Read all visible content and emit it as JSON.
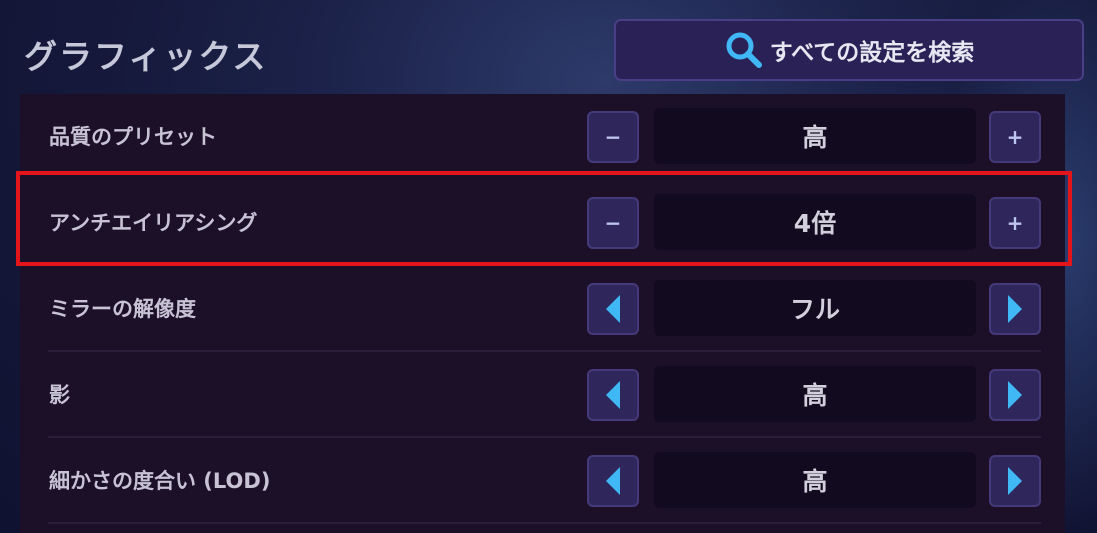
{
  "header": {
    "title": "グラフィックス",
    "search_label": "すべての設定を検索"
  },
  "settings": [
    {
      "label": "品質のプリセット",
      "value": "高",
      "control": "stepper",
      "decrement": "−",
      "increment": "+"
    },
    {
      "label": "アンチエイリアシング",
      "value": "4倍",
      "control": "stepper",
      "decrement": "−",
      "increment": "+",
      "highlighted": true
    },
    {
      "label": "ミラーの解像度",
      "value": "フル",
      "control": "arrows"
    },
    {
      "label": "影",
      "value": "高",
      "control": "arrows"
    },
    {
      "label": "細かさの度合い (LOD)",
      "value": "高",
      "control": "arrows"
    }
  ],
  "colors": {
    "accent_arrow": "#3fb8f5",
    "highlight_border": "#e3141a",
    "panel_bg": "#1c0f28",
    "button_bg": "#2f275c"
  },
  "icons": {
    "search": "search-icon",
    "arrow_left": "arrow-left-icon",
    "arrow_right": "arrow-right-icon",
    "minus": "minus-icon",
    "plus": "plus-icon"
  }
}
